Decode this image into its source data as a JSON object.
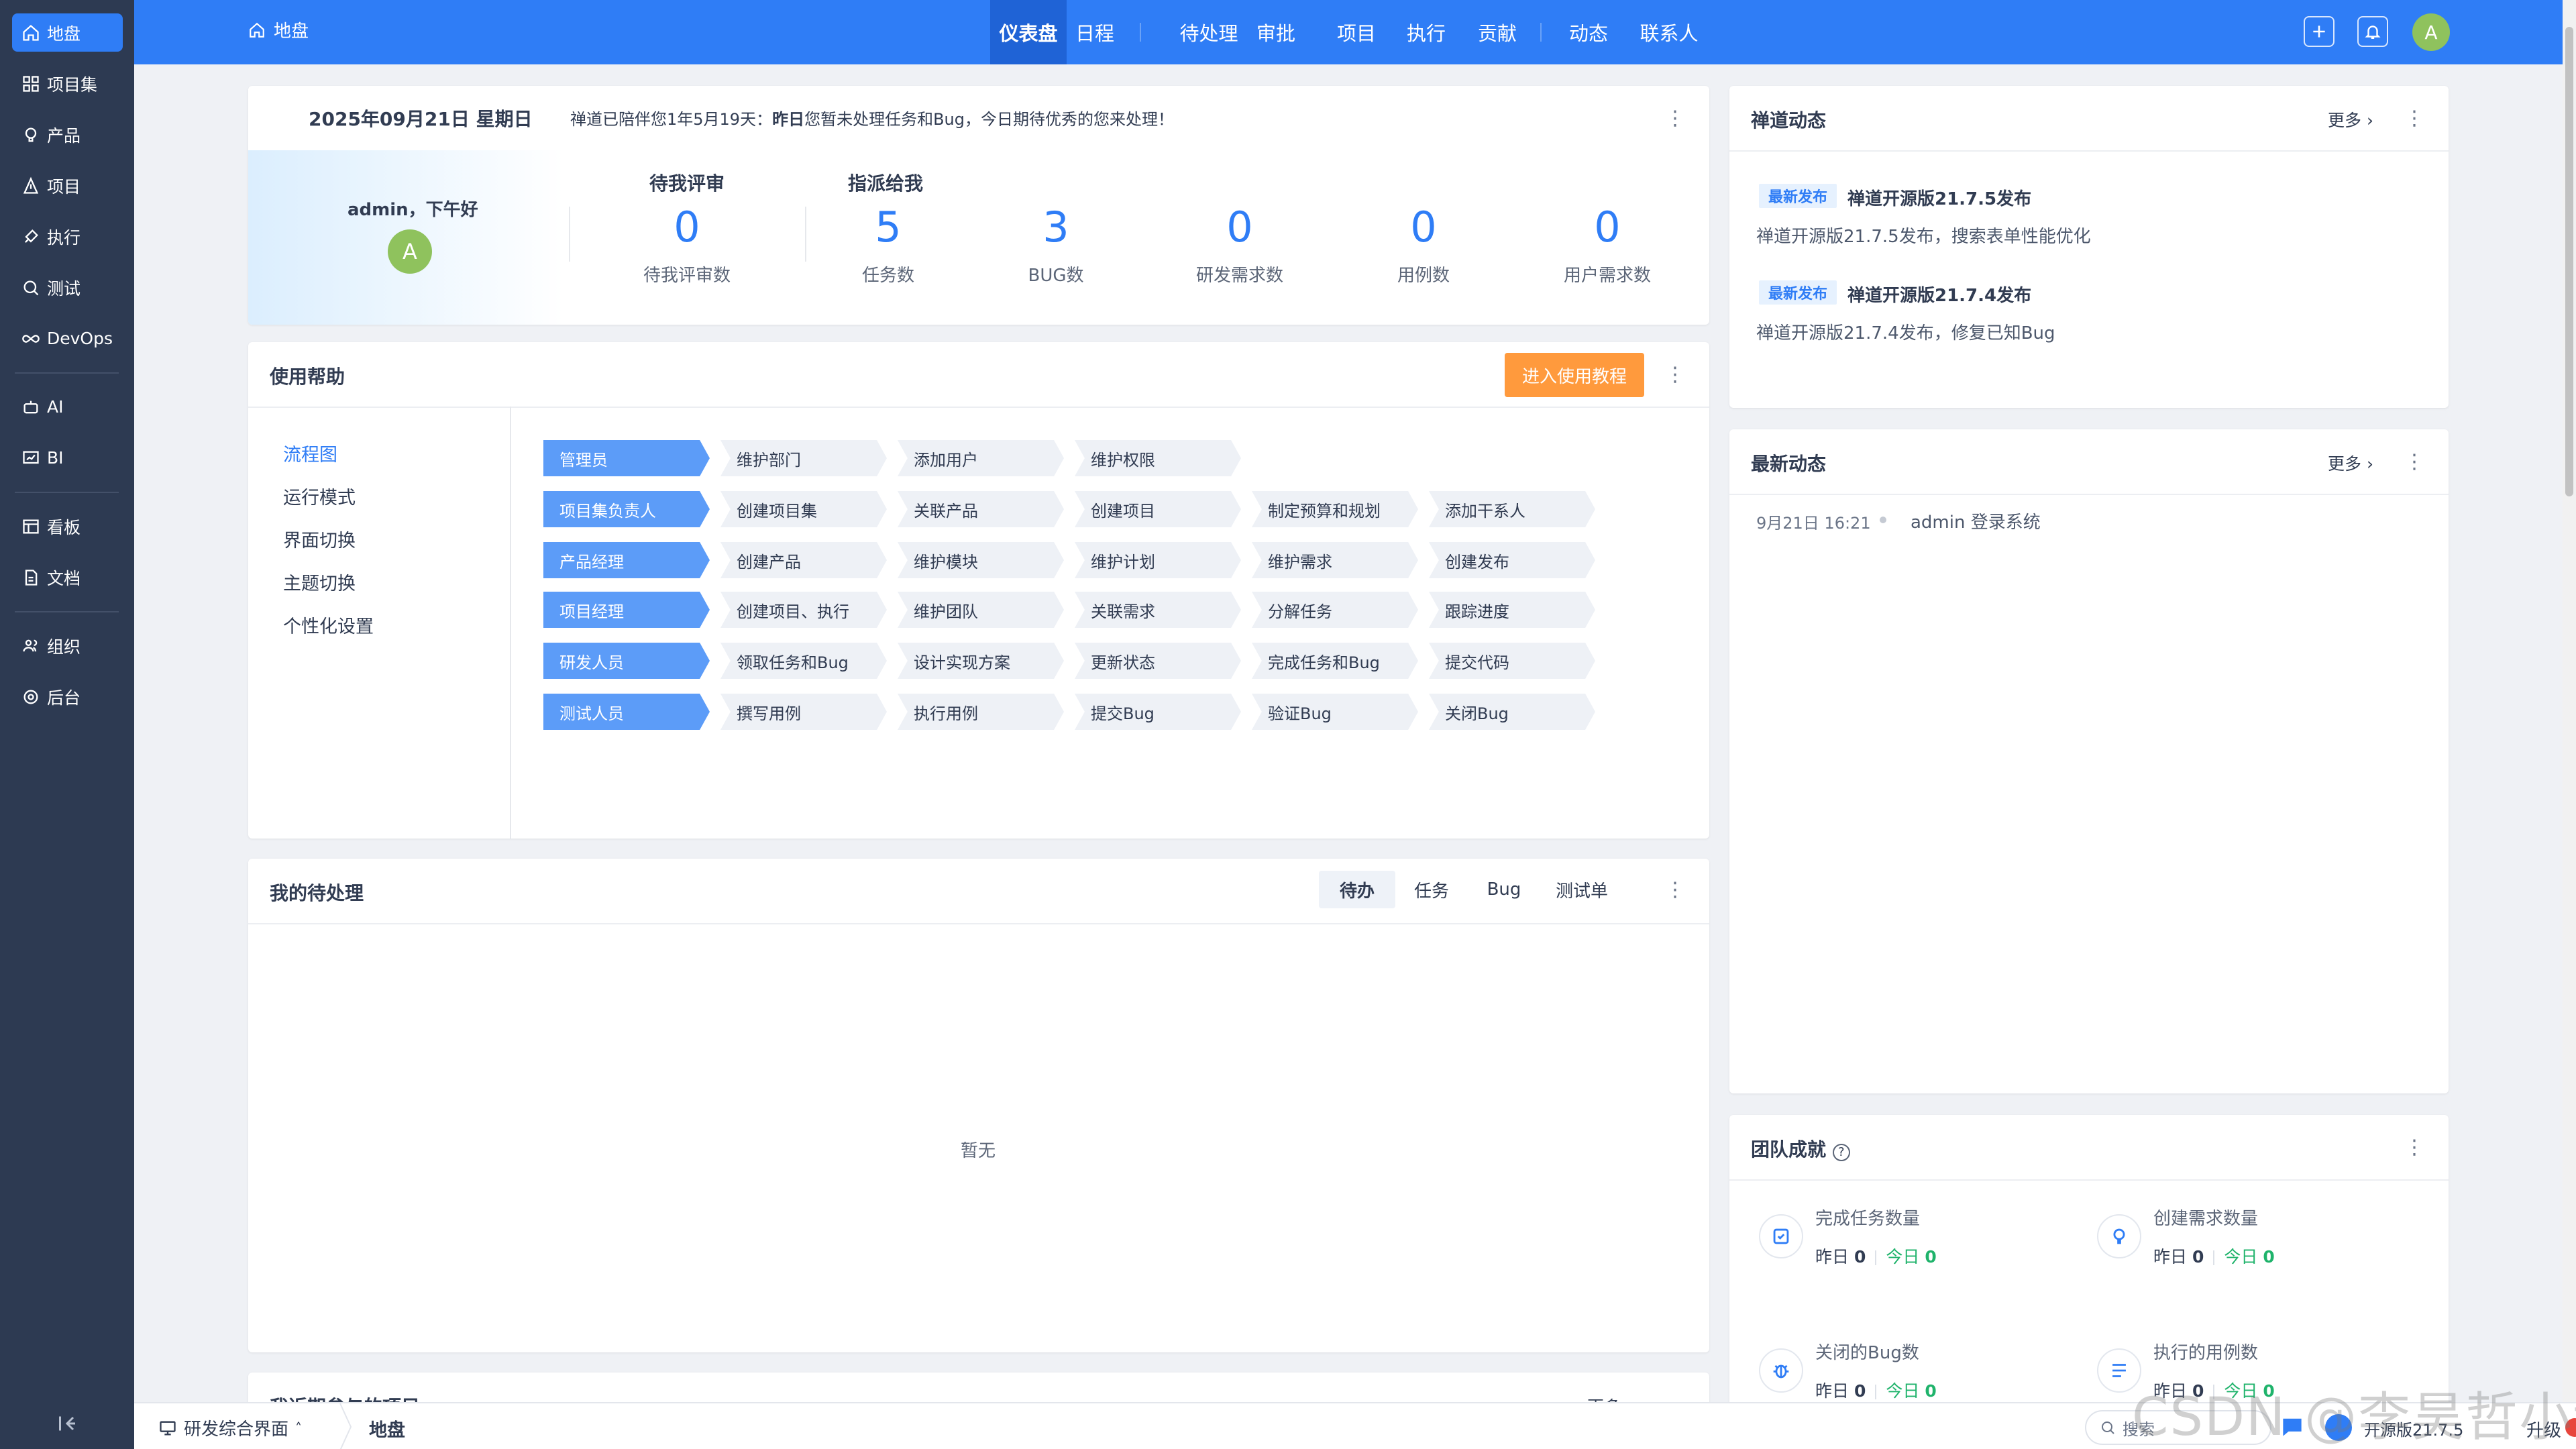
{
  "app": {
    "accent": "#2f7df6",
    "sidebar_bg": "#2d3a52"
  },
  "sidebar": {
    "items": [
      {
        "label": "地盘",
        "icon": "home-icon",
        "active": true
      },
      {
        "label": "项目集",
        "icon": "grid-icon"
      },
      {
        "label": "产品",
        "icon": "lightbulb-icon"
      },
      {
        "label": "项目",
        "icon": "project-icon"
      },
      {
        "label": "执行",
        "icon": "rocket-icon"
      },
      {
        "label": "测试",
        "icon": "search-icon"
      },
      {
        "label": "DevOps",
        "icon": "infinity-icon"
      },
      {
        "label": "AI",
        "icon": "robot-icon"
      },
      {
        "label": "BI",
        "icon": "chart-icon"
      },
      {
        "label": "看板",
        "icon": "kanban-icon"
      },
      {
        "label": "文档",
        "icon": "document-icon"
      },
      {
        "label": "组织",
        "icon": "people-icon"
      },
      {
        "label": "后台",
        "icon": "gear-icon"
      }
    ]
  },
  "topbar": {
    "home_label": "地盘",
    "nav": [
      "仪表盘",
      "日程",
      "待处理",
      "审批",
      "项目",
      "执行",
      "贡献",
      "动态",
      "联系人"
    ],
    "active_nav": "仪表盘",
    "avatar_letter": "A"
  },
  "welcome": {
    "date": "2025年09月21日 星期日",
    "message_prefix": "禅道已陪伴您1年5月19天：",
    "message_bold": "昨日",
    "message_suffix": "您暂未处理任务和Bug，今日期待优秀的您来处理！",
    "greeting": "admin，下午好",
    "avatar_letter": "A",
    "review_group": "待我评审",
    "assigned_group": "指派给我",
    "stats": [
      {
        "value": "0",
        "label": "待我评审数"
      },
      {
        "value": "5",
        "label": "任务数"
      },
      {
        "value": "3",
        "label": "BUG数"
      },
      {
        "value": "0",
        "label": "研发需求数"
      },
      {
        "value": "0",
        "label": "用例数"
      },
      {
        "value": "0",
        "label": "用户需求数"
      }
    ]
  },
  "help": {
    "title": "使用帮助",
    "button": "进入使用教程",
    "menu": [
      "流程图",
      "运行模式",
      "界面切换",
      "主题切换",
      "个性化设置"
    ],
    "active_menu": "流程图",
    "flow": [
      {
        "role": "管理员",
        "steps": [
          "维护部门",
          "添加用户",
          "维护权限"
        ]
      },
      {
        "role": "项目集负责人",
        "steps": [
          "创建项目集",
          "关联产品",
          "创建项目",
          "制定预算和规划",
          "添加干系人"
        ]
      },
      {
        "role": "产品经理",
        "steps": [
          "创建产品",
          "维护模块",
          "维护计划",
          "维护需求",
          "创建发布"
        ]
      },
      {
        "role": "项目经理",
        "steps": [
          "创建项目、执行",
          "维护团队",
          "关联需求",
          "分解任务",
          "跟踪进度"
        ]
      },
      {
        "role": "研发人员",
        "steps": [
          "领取任务和Bug",
          "设计实现方案",
          "更新状态",
          "完成任务和Bug",
          "提交代码"
        ]
      },
      {
        "role": "测试人员",
        "steps": [
          "撰写用例",
          "执行用例",
          "提交Bug",
          "验证Bug",
          "关闭Bug"
        ]
      }
    ]
  },
  "todo": {
    "title": "我的待处理",
    "tabs": [
      "待办",
      "任务",
      "Bug",
      "测试单"
    ],
    "active_tab": "待办",
    "empty": "暂无"
  },
  "partial": {
    "title": "我近期参与的项目",
    "more": "更多"
  },
  "zentao_news": {
    "title": "禅道动态",
    "more": "更多",
    "items": [
      {
        "badge": "最新发布",
        "title": "禅道开源版21.7.5发布",
        "desc": "禅道开源版21.7.5发布，搜索表单性能优化"
      },
      {
        "badge": "最新发布",
        "title": "禅道开源版21.7.4发布",
        "desc": "禅道开源版21.7.4发布，修复已知Bug"
      }
    ]
  },
  "latest": {
    "title": "最新动态",
    "more": "更多",
    "items": [
      {
        "time": "9月21日 16:21",
        "text": "admin 登录系统"
      }
    ]
  },
  "team": {
    "title": "团队成就",
    "metrics": [
      {
        "label": "完成任务数量",
        "icon": "task-check-icon",
        "yesterday_label": "昨日",
        "yesterday": "0",
        "today_label": "今日",
        "today": "0"
      },
      {
        "label": "创建需求数量",
        "icon": "bulb-icon",
        "yesterday_label": "昨日",
        "yesterday": "0",
        "today_label": "今日",
        "today": "0"
      },
      {
        "label": "关闭的Bug数",
        "icon": "bug-icon",
        "yesterday_label": "昨日",
        "yesterday": "0",
        "today_label": "今日",
        "today": "0"
      },
      {
        "label": "执行的用例数",
        "icon": "case-icon",
        "yesterday_label": "昨日",
        "yesterday": "0",
        "today_label": "今日",
        "today": "0"
      }
    ]
  },
  "bottombar": {
    "workspace": "研发综合界面",
    "current": "地盘",
    "search_placeholder": "搜索",
    "version": "开源版21.7.5",
    "upgrade": "升级"
  },
  "watermark": "CSDN @李昊哲小课"
}
